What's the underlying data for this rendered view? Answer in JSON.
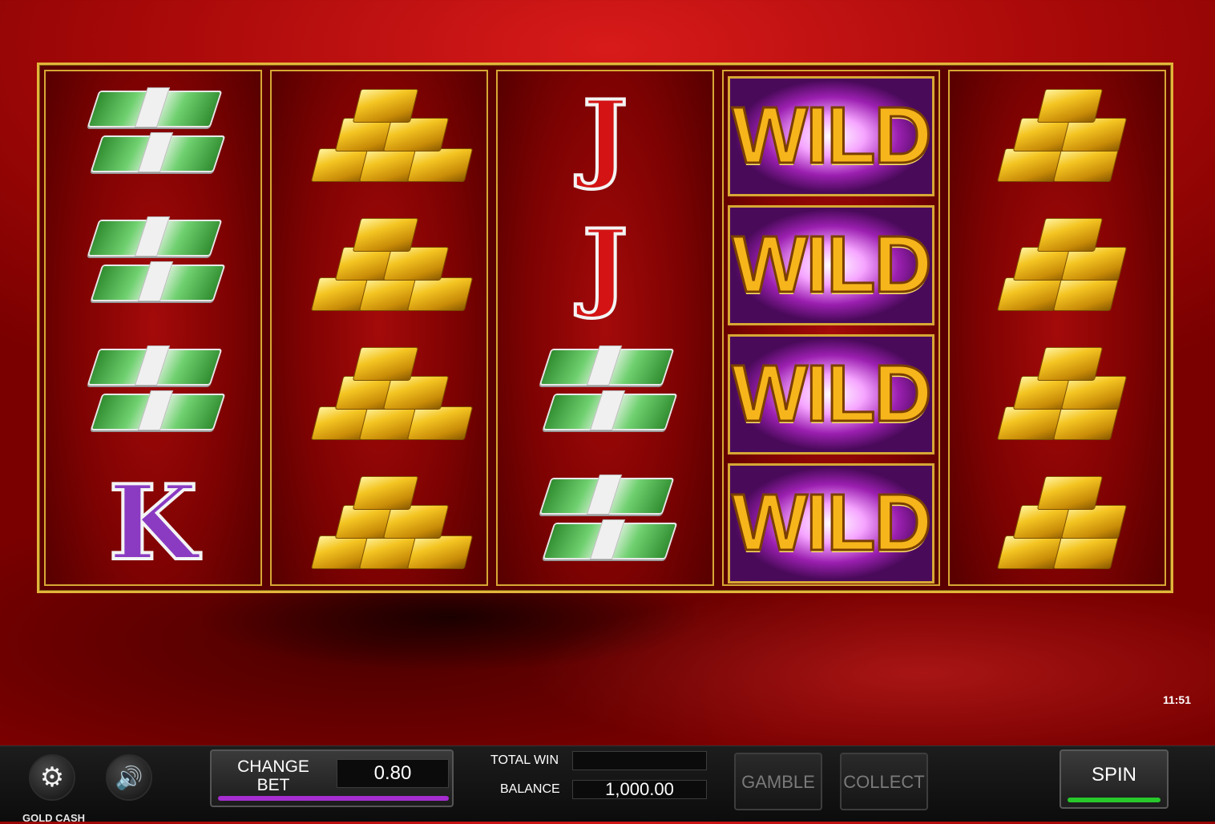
{
  "game": {
    "name": "GOLD CASH",
    "clock": "11:51"
  },
  "reels": [
    [
      "money",
      "money",
      "money",
      "king"
    ],
    [
      "gold",
      "gold",
      "gold",
      "gold"
    ],
    [
      "jack",
      "jack",
      "money",
      "money"
    ],
    [
      "wild",
      "wild",
      "wild",
      "wild"
    ],
    [
      "gold",
      "gold",
      "gold",
      "gold"
    ]
  ],
  "symbols": {
    "jack_text": "J",
    "king_text": "K",
    "wild_text": "WILD"
  },
  "controls": {
    "settings_icon": "gear-icon",
    "sound_icon": "speaker-icon",
    "change_bet_label": "CHANGE BET",
    "bet_value": "0.80",
    "total_win_label": "TOTAL WIN",
    "total_win_value": "",
    "balance_label": "BALANCE",
    "balance_value": "1,000.00",
    "gamble_label": "GAMBLE",
    "collect_label": "COLLECT",
    "spin_label": "SPIN"
  },
  "colors": {
    "accent_gold": "#e2b53a",
    "bet_bar": "#a62dd0",
    "spin_bar": "#27c92b",
    "background_red": "#a50808"
  }
}
